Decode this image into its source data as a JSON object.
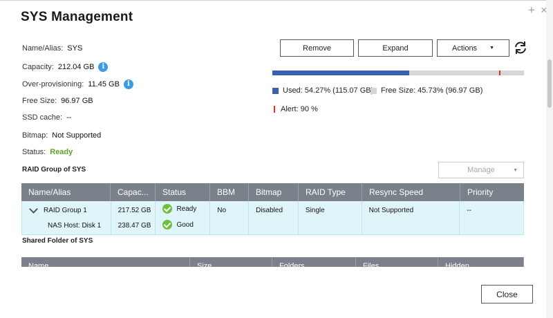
{
  "window": {
    "title": "SYS  Management",
    "plus_label": "+",
    "close_label": "×"
  },
  "info": {
    "name_label": "Name/Alias:",
    "name_value": "SYS",
    "capacity_label": "Capacity:",
    "capacity_value": "212.04 GB",
    "overprov_label": "Over-provisioning:",
    "overprov_value": "11.45 GB",
    "free_label": "Free Size:",
    "free_value": "96.97 GB",
    "ssd_label": "SSD cache:",
    "ssd_value": "--",
    "bitmap_label": "Bitmap:",
    "bitmap_value": "Not Supported",
    "status_label": "Status:",
    "status_value": "Ready",
    "info_icon_glyph": "i"
  },
  "toolbar": {
    "remove_label": "Remove",
    "expand_label": "Expand",
    "actions_label": "Actions",
    "actions_caret": "▼"
  },
  "usage": {
    "used_fraction": 0.5427,
    "alert_fraction": 0.9,
    "used_color": "#3c5fb4",
    "free_color": "#d6d6d6",
    "alert_color": "#d9342b",
    "used_legend": "Used: 54.27% (115.07 GB)",
    "free_legend": "Free Size: 45.73% (96.97 GB)",
    "alert_legend": "Alert: 90 %"
  },
  "raid": {
    "section_label": "RAID Group of SYS",
    "manage_label": "Manage",
    "manage_caret": "▼",
    "columns": [
      "Name/Alias",
      "Capac...",
      "Status",
      "BBM",
      "Bitmap",
      "RAID Type",
      "Resync Speed",
      "Priority"
    ],
    "group": {
      "name": "RAID Group 1",
      "capacity": "217.52 GB",
      "status": "Ready",
      "bbm": "No",
      "bitmap": "Disabled",
      "raid_type": "Single",
      "resync": "Not Supported",
      "priority": "--"
    },
    "disk": {
      "name": "NAS Host: Disk 1",
      "capacity": "238.47 GB",
      "status": "Good"
    }
  },
  "shared": {
    "section_label": "Shared Folder of SYS",
    "columns": [
      "Name",
      "Size",
      "Folders",
      "Files",
      "Hidden"
    ]
  },
  "footer": {
    "close_label": "Close"
  }
}
